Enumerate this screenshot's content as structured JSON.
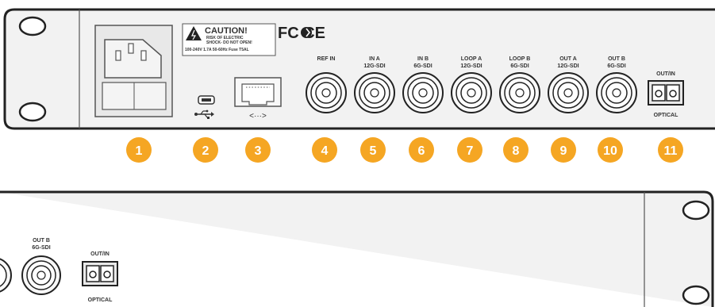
{
  "panel_top": {
    "caution": {
      "title": "CAUTION!",
      "line1": "RISK OF ELECTRIC",
      "line2": "SHOCK- DO NOT OPEN!",
      "rating": "100-240V 1.7A 50-60Hz Fuse T5AL"
    },
    "cert_marks": "FC  CE",
    "usb_symbol": "⭠",
    "ethernet_symbol": "<···>",
    "connectors": [
      {
        "line1": "REF IN",
        "line2": ""
      },
      {
        "line1": "IN A",
        "line2": "12G-SDI"
      },
      {
        "line1": "IN B",
        "line2": "6G-SDI"
      },
      {
        "line1": "LOOP A",
        "line2": "12G-SDI"
      },
      {
        "line1": "LOOP B",
        "line2": "6G-SDI"
      },
      {
        "line1": "OUT A",
        "line2": "12G-SDI"
      },
      {
        "line1": "OUT B",
        "line2": "6G-SDI"
      }
    ],
    "optical": {
      "top": "OUT/IN",
      "bottom": "OPTICAL"
    }
  },
  "callouts": [
    "1",
    "2",
    "3",
    "4",
    "5",
    "6",
    "7",
    "8",
    "9",
    "10",
    "11"
  ],
  "callout_color": "#f5a623",
  "panel_bottom": {
    "connector": {
      "line1": "OUT B",
      "line2": "6G-SDI"
    },
    "optical": {
      "top": "OUT/IN",
      "bottom": "OPTICAL"
    }
  }
}
